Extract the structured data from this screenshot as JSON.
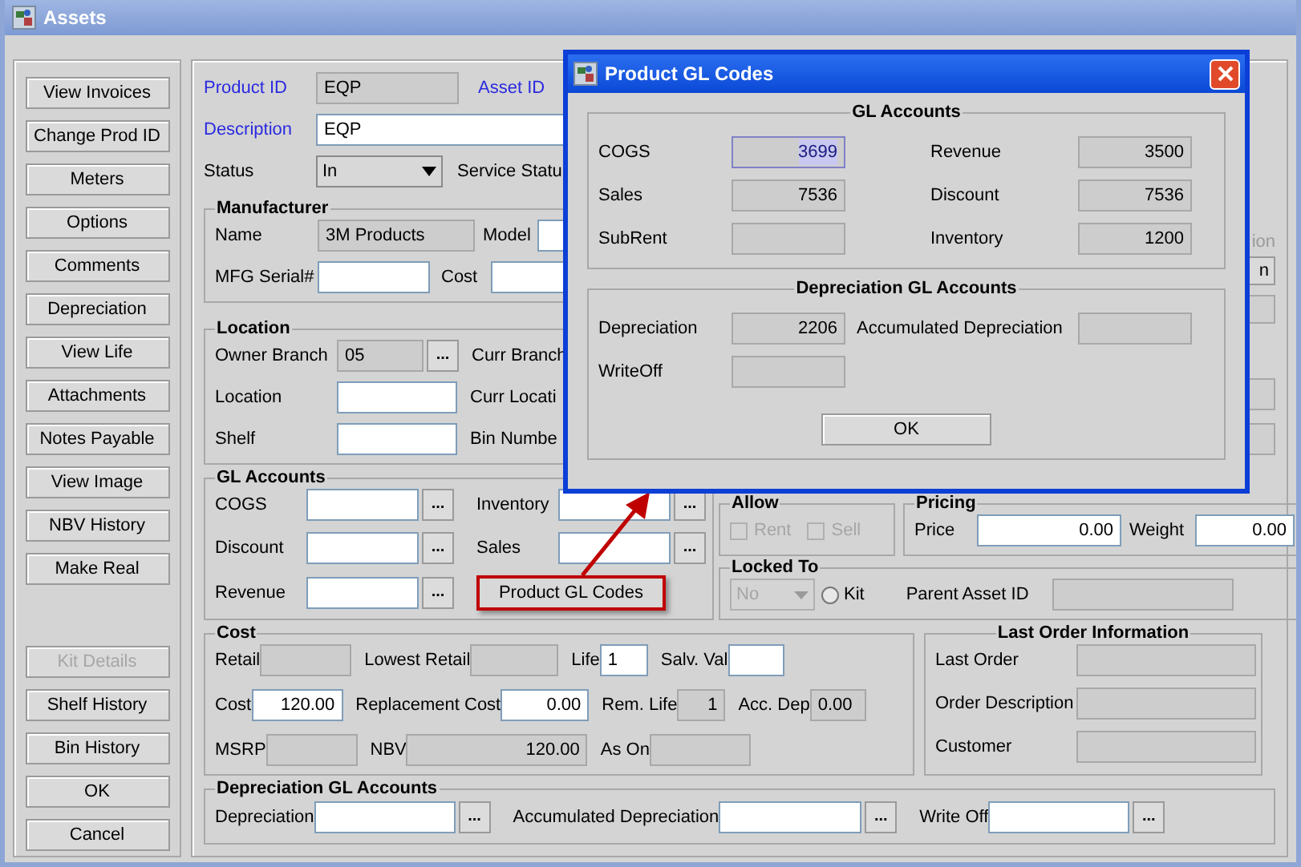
{
  "window": {
    "title": "Assets"
  },
  "sidebar": {
    "top": [
      {
        "label": "View Invoices",
        "disabled": false
      },
      {
        "label": "Change Prod ID",
        "disabled": false
      },
      {
        "label": "Meters",
        "disabled": false
      },
      {
        "label": "Options",
        "disabled": false
      },
      {
        "label": "Comments",
        "disabled": false
      },
      {
        "label": "Depreciation",
        "disabled": false
      },
      {
        "label": "View Life",
        "disabled": false
      },
      {
        "label": "Attachments",
        "disabled": false
      },
      {
        "label": "Notes Payable",
        "disabled": false
      },
      {
        "label": "View Image",
        "disabled": false
      },
      {
        "label": "NBV History",
        "disabled": false
      },
      {
        "label": "Make Real",
        "disabled": false
      }
    ],
    "bottom": [
      {
        "label": "Kit Details",
        "disabled": true
      },
      {
        "label": "Shelf History",
        "disabled": false
      },
      {
        "label": "Bin History",
        "disabled": false
      },
      {
        "label": "OK",
        "disabled": false
      },
      {
        "label": "Cancel",
        "disabled": false
      }
    ]
  },
  "header": {
    "product_id": {
      "label": "Product ID",
      "value": "EQP",
      "editable": false
    },
    "asset_id": {
      "label": "Asset ID"
    },
    "description": {
      "label": "Description",
      "value": "EQP",
      "editable": true
    },
    "status": {
      "label": "Status",
      "value": "In"
    },
    "service_status": {
      "label": "Service Statu"
    }
  },
  "manufacturer": {
    "title": "Manufacturer",
    "name": {
      "label": "Name",
      "value": "3M Products",
      "editable": false
    },
    "model": {
      "label": "Model",
      "editable": true
    },
    "serial": {
      "label": "MFG Serial#",
      "editable": true
    },
    "cost": {
      "label": "Cost",
      "editable": true
    }
  },
  "location": {
    "title": "Location",
    "rows": [
      {
        "field": {
          "label": "Owner Branch",
          "value": "05",
          "editable": false,
          "browse": "..."
        },
        "side_label": "Curr Branch"
      },
      {
        "field": {
          "label": "Location",
          "editable": true
        },
        "side_label": "Curr Locati"
      },
      {
        "field": {
          "label": "Shelf",
          "editable": true
        },
        "side_label": "Bin Numbe"
      }
    ]
  },
  "right_edge": {
    "label": "ion",
    "button": "n"
  },
  "gl_accounts": {
    "title": "GL Accounts",
    "fields": [
      {
        "label": "COGS",
        "editable": true,
        "browse": "..."
      },
      {
        "label": "Inventory",
        "editable": true,
        "browse": "..."
      },
      {
        "label": "Discount",
        "editable": true,
        "browse": "..."
      },
      {
        "label": "Sales",
        "editable": true,
        "browse": "..."
      },
      {
        "label": "Revenue",
        "editable": true,
        "browse": "..."
      }
    ],
    "codes_button": {
      "label": "Product GL Codes",
      "highlighted": true
    }
  },
  "allow": {
    "title": "Allow",
    "options": [
      {
        "label": "Rent",
        "checked": false,
        "disabled": true
      },
      {
        "label": "Sell",
        "checked": false,
        "disabled": true
      }
    ]
  },
  "pricing": {
    "title": "Pricing",
    "fields": [
      {
        "label": "Price",
        "value": "0.00",
        "editable": true
      },
      {
        "label": "Weight",
        "value": "0.00",
        "editable": true
      }
    ]
  },
  "locked_to": {
    "title": "Locked To",
    "dropdown": {
      "value": "No",
      "disabled": true
    },
    "kit": {
      "label": "Kit",
      "selected": false
    },
    "parent_asset": {
      "label": "Parent Asset ID",
      "editable": false
    }
  },
  "cost": {
    "title": "Cost",
    "rows": [
      [
        {
          "label": "Retail",
          "editable": false
        },
        {
          "label": "Lowest Retail",
          "editable": false
        },
        {
          "label": "Life",
          "value": "1",
          "editable": true
        },
        {
          "label": "Salv. Val",
          "editable": true
        }
      ],
      [
        {
          "label": "Cost",
          "value": "120.00",
          "editable": true
        },
        {
          "label": "Replacement Cost",
          "value": "0.00",
          "editable": true
        },
        {
          "label": "Rem. Life",
          "value": "1",
          "editable": false
        },
        {
          "label": "Acc. Dep",
          "value": "0.00",
          "editable": false
        }
      ],
      [
        {
          "label": "MSRP",
          "editable": false
        },
        {
          "label": "NBV",
          "value": "120.00",
          "editable": false
        },
        {
          "label": "As On",
          "editable": false
        }
      ]
    ]
  },
  "last_order": {
    "title": "Last Order Information",
    "fields": [
      {
        "label": "Last Order",
        "editable": false
      },
      {
        "label": "Order Description",
        "editable": false
      },
      {
        "label": "Customer",
        "editable": false
      }
    ]
  },
  "depreciation_gl": {
    "title": "Depreciation GL Accounts",
    "fields": [
      {
        "label": "Depreciation",
        "editable": true,
        "browse": "..."
      },
      {
        "label": "Accumulated Depreciation",
        "editable": true,
        "browse": "..."
      },
      {
        "label": "Write Off",
        "editable": true,
        "browse": "..."
      }
    ]
  },
  "dialog": {
    "title": "Product GL Codes",
    "gl_accounts": {
      "title": "GL Accounts",
      "fields": [
        {
          "label": "COGS",
          "value": "3699",
          "editable": false,
          "highlighted": true
        },
        {
          "label": "Revenue",
          "value": "3500",
          "editable": false,
          "highlighted": false
        },
        {
          "label": "Sales",
          "value": "7536",
          "editable": false,
          "highlighted": false
        },
        {
          "label": "Discount",
          "value": "7536",
          "editable": false,
          "highlighted": false
        },
        {
          "label": "SubRent",
          "editable": false,
          "highlighted": false
        },
        {
          "label": "Inventory",
          "value": "1200",
          "editable": false,
          "highlighted": false
        }
      ]
    },
    "depreciation": {
      "title": "Depreciation GL Accounts",
      "fields": [
        {
          "label": "Depreciation",
          "value": "2206",
          "editable": false,
          "highlighted": false
        },
        {
          "label": "Accumulated Depreciation",
          "editable": false,
          "highlighted": false
        },
        {
          "label": "WriteOff",
          "editable": false,
          "highlighted": false
        }
      ]
    },
    "ok": {
      "label": "OK"
    }
  }
}
